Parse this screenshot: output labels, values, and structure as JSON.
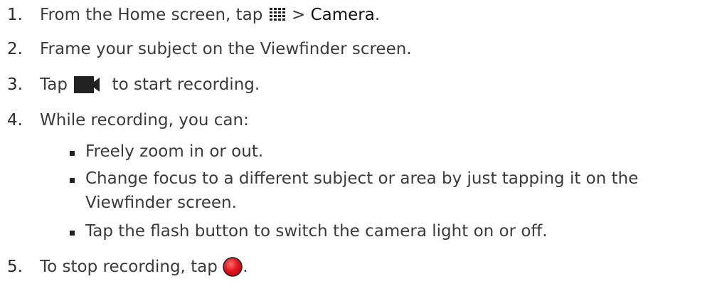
{
  "steps": [
    {
      "num": "1.",
      "pre": "From the Home screen, tap ",
      "icon": "apps-grid-icon",
      "mid": " > ",
      "strong": "Camera",
      "post": "."
    },
    {
      "num": "2.",
      "text": "Frame your subject on the Viewfinder screen."
    },
    {
      "num": "3.",
      "pre": "Tap ",
      "icon": "video-camera-icon",
      "post": " to start recording."
    },
    {
      "num": "4.",
      "text": "While recording, you can:"
    },
    {
      "num": "5.",
      "pre": "To stop recording, tap ",
      "icon": "red-record-icon",
      "post": "."
    }
  ],
  "bullets": [
    "Freely zoom in or out.",
    "Change focus to a different subject or area by just tapping it on the",
    "Viewfinder screen.",
    "Tap the flash button to switch the camera light on or off."
  ],
  "colors": {
    "text": "#3a3a3a",
    "icon_dark": "#222222",
    "record_red": "#e3131b"
  }
}
